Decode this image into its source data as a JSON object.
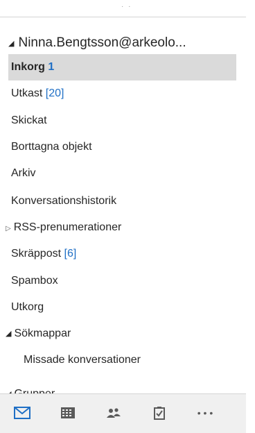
{
  "top": {
    "dots": "· ·"
  },
  "account": {
    "name": "Ninna.Bengtsson@arkeolo..."
  },
  "folders": [
    {
      "label": "Inkorg",
      "count": "1"
    },
    {
      "label": "Utkast",
      "count": "[20]"
    },
    {
      "label": "Skickat"
    },
    {
      "label": "Borttagna objekt"
    },
    {
      "label": "Arkiv"
    },
    {
      "label": "Konversationshistorik"
    },
    {
      "label": "RSS-prenumerationer"
    },
    {
      "label": "Skräppost",
      "count": "[6]"
    },
    {
      "label": "Spambox"
    },
    {
      "label": "Utkorg"
    }
  ],
  "search_folders": {
    "label": "Sökmappar",
    "items": [
      {
        "label": "Missade konversationer"
      }
    ]
  },
  "groups": {
    "label": "Grupper"
  },
  "nav": {
    "items": [
      "mail-icon",
      "calendar-icon",
      "people-icon",
      "tasks-icon",
      "more-icon"
    ],
    "more_label": "• • •"
  },
  "colors": {
    "accent": "#1f6fc5",
    "selected_bg": "#dadada",
    "nav_bg": "#f0f0f0"
  }
}
